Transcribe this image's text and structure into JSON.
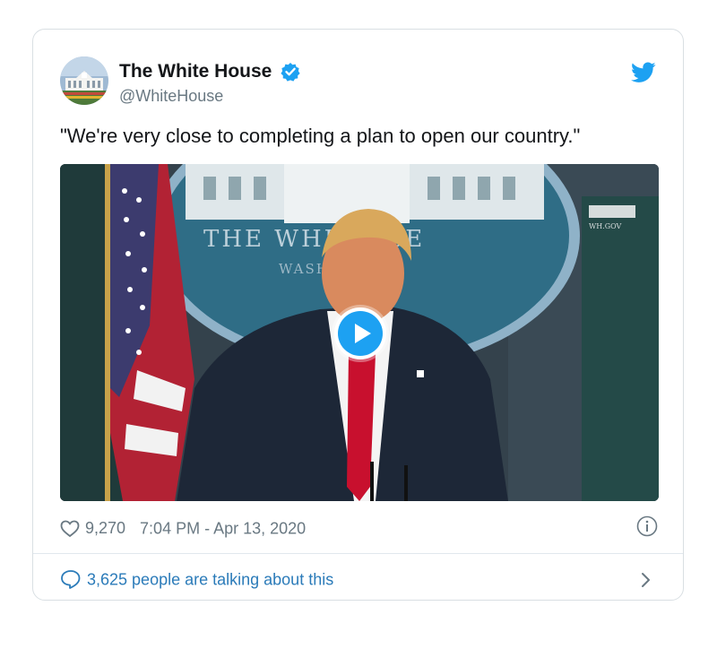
{
  "tweet": {
    "display_name": "The White House",
    "handle": "@WhiteHouse",
    "verified": true,
    "text": "\"We're very close to completing a plan to open our country.\"",
    "likes": "9,270",
    "timestamp": "7:04 PM - Apr 13, 2020",
    "talking_text": "3,625 people are talking about this"
  },
  "media": {
    "type": "video",
    "backdrop_seal_text": "THE WHIT   USE",
    "backdrop_sub_text": "WASH",
    "corner_sign_text": "WH.GOV"
  },
  "icons": {
    "verified": "verified-badge-icon",
    "bird": "twitter-bird-icon",
    "like": "heart-icon",
    "info": "info-icon",
    "reply": "speech-bubble-icon",
    "chevron": "chevron-right-icon",
    "play": "play-icon"
  },
  "colors": {
    "accent": "#1da1f2",
    "link": "#2b7bb9",
    "text": "#141619",
    "muted": "#697882"
  }
}
